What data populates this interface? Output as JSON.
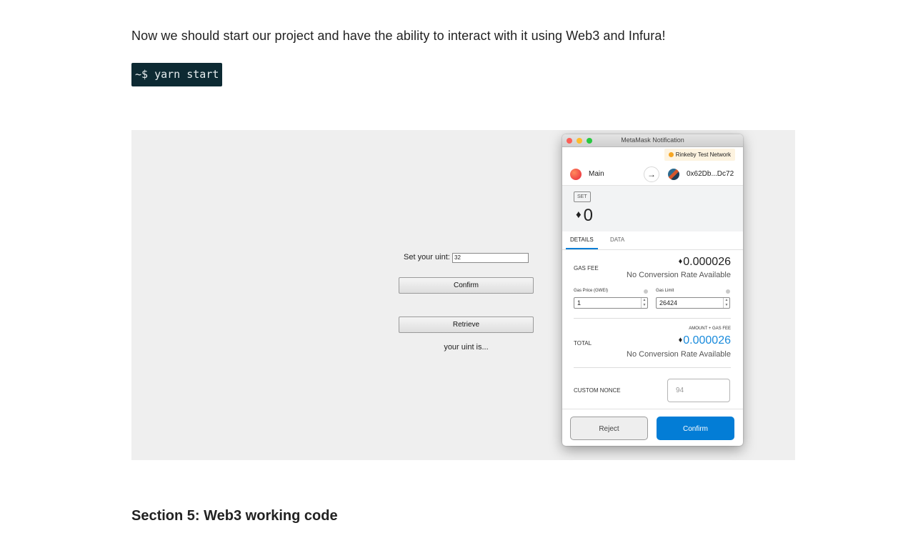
{
  "intro_text": "Now we should start our project and have the ability to interact with it using Web3 and Infura!",
  "code_snippet": "~$ yarn start",
  "dapp": {
    "uint_label": "Set your uint:",
    "uint_value": "32",
    "confirm_label": "Confirm",
    "retrieve_label": "Retrieve",
    "result_text": "your uint is..."
  },
  "metamask": {
    "window_title": "MetaMask Notification",
    "network": "Rinkeby Test Network",
    "from_account": "Main",
    "to_address": "0x62Db...Dc72",
    "method_badge": "SET",
    "amount": "0",
    "tabs": [
      "DETAILS",
      "DATA"
    ],
    "gas_fee_label": "GAS FEE",
    "gas_fee_value": "0.000026",
    "no_conversion": "No Conversion Rate Available",
    "gas_price_label": "Gas Price (GWEI)",
    "gas_price_value": "1",
    "gas_limit_label": "Gas Limit",
    "gas_limit_value": "26424",
    "amount_gas_label": "AMOUNT + GAS FEE",
    "total_label": "TOTAL",
    "total_value": "0.000026",
    "custom_nonce_label": "CUSTOM NONCE",
    "custom_nonce_placeholder": "94",
    "reject_label": "Reject",
    "confirm_label": "Confirm",
    "colors": {
      "accent": "#037dd6",
      "total_value": "#1a8bdc",
      "network_dot": "#f6a623"
    }
  },
  "section_title": "Section 5: Web3 working code"
}
